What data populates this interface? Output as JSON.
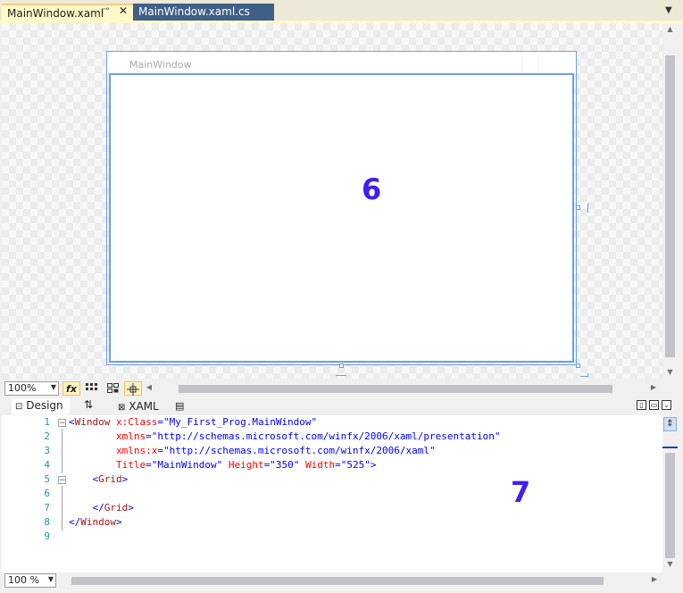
{
  "tabs": [
    {
      "label": "MainWindow.xaml",
      "active": true
    },
    {
      "label": "MainWindow.xaml.cs",
      "active": false
    }
  ],
  "tab_icons": {
    "pin": "pin-icon",
    "close": "close-icon",
    "overflow": "dropdown-icon"
  },
  "designer": {
    "window_title": "MainWindow",
    "annotation": "6"
  },
  "design_toolbar": {
    "zoom": "100%",
    "fx_label": "fx"
  },
  "split": {
    "design_label": "Design",
    "swap_glyph": "⇅",
    "xaml_label": "XAML"
  },
  "code": {
    "line_numbers": [
      "1",
      "2",
      "3",
      "4",
      "5",
      "6",
      "7",
      "8",
      "9"
    ],
    "annotation": "7"
  },
  "bottom_toolbar": {
    "zoom": "100 %"
  },
  "colors": {
    "accent_blue": "#6ea0e6",
    "annotation_purple": "#3f1ff0",
    "tab_active": "#fff9c9",
    "tab_inactive": "#3f5f86"
  }
}
